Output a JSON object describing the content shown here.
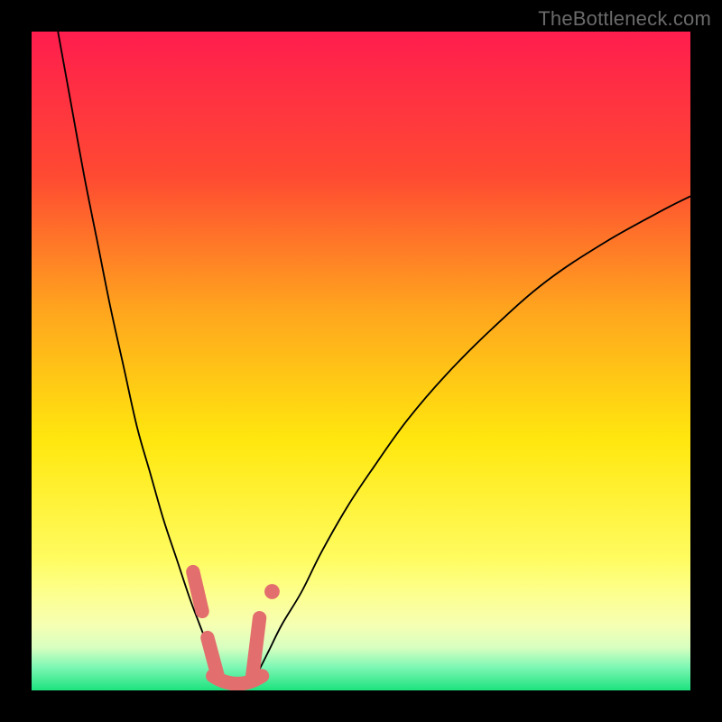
{
  "watermark": {
    "text": "TheBottleneck.com"
  },
  "chart_data": {
    "type": "line",
    "title": "",
    "xlabel": "",
    "ylabel": "",
    "xlim": [
      0,
      100
    ],
    "ylim": [
      0,
      100
    ],
    "axes_visible": false,
    "grid": false,
    "background_gradient": {
      "direction": "vertical",
      "stops": [
        {
          "pos": 0.0,
          "color": "#ff1d4e"
        },
        {
          "pos": 0.22,
          "color": "#ff4a32"
        },
        {
          "pos": 0.42,
          "color": "#ffa41e"
        },
        {
          "pos": 0.62,
          "color": "#ffe70e"
        },
        {
          "pos": 0.8,
          "color": "#fffc60"
        },
        {
          "pos": 0.85,
          "color": "#fdff8c"
        },
        {
          "pos": 0.9,
          "color": "#f6ffb2"
        },
        {
          "pos": 0.935,
          "color": "#d8ffc0"
        },
        {
          "pos": 0.965,
          "color": "#7cf7b4"
        },
        {
          "pos": 1.0,
          "color": "#1de27e"
        }
      ]
    },
    "series": [
      {
        "name": "left-curve",
        "color": "#000000",
        "x": [
          4,
          6,
          8,
          10,
          12,
          14,
          16,
          18,
          20,
          22,
          24,
          25.5,
          27,
          28
        ],
        "y": [
          100,
          89,
          78,
          68,
          58,
          49,
          40,
          33,
          26,
          20,
          14,
          10,
          6,
          2
        ]
      },
      {
        "name": "right-curve",
        "color": "#000000",
        "x": [
          34,
          36,
          38,
          41,
          44,
          48,
          52,
          57,
          63,
          70,
          78,
          87,
          96,
          100
        ],
        "y": [
          2,
          6,
          10,
          15,
          21,
          28,
          34,
          41,
          48,
          55,
          62,
          68,
          73,
          75
        ]
      }
    ],
    "left_highlight": {
      "name": "left-segment-markers",
      "color": "#e36e6e",
      "segment_top": {
        "x": 24.5,
        "y0": 18,
        "y1": 12
      },
      "segment_bot": {
        "x": 27.5,
        "y0": 8,
        "y1": 2
      }
    },
    "right_highlight": {
      "name": "right-segment-markers",
      "color": "#e36e6e",
      "dot_top": {
        "x": 36.5,
        "y": 15
      },
      "segment": {
        "x": 35.5,
        "y0": 11,
        "y1": 2
      }
    },
    "bottom_arc": {
      "name": "bottom-connecting-arc",
      "color": "#e36e6e",
      "x0": 27.5,
      "x1": 35.0,
      "y": 1.2
    }
  }
}
